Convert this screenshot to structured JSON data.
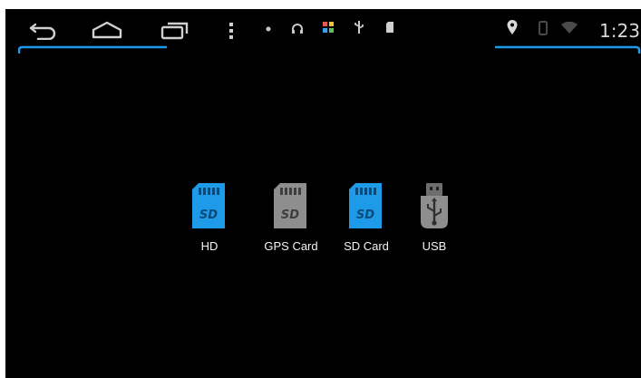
{
  "status_bar": {
    "nav": [
      {
        "name": "back",
        "icon": "back-arrow-icon"
      },
      {
        "name": "home",
        "icon": "home-icon"
      },
      {
        "name": "recents",
        "icon": "recent-apps-icon"
      },
      {
        "name": "menu",
        "icon": "overflow-menu-icon"
      }
    ],
    "notifications": [
      "notification-dot-icon",
      "headphones-icon",
      "app-grid-icon",
      "usb-icon",
      "sd-card-icon"
    ],
    "system_icons": [
      "location-icon",
      "vibrate-icon",
      "wifi-icon"
    ],
    "time": "1:23"
  },
  "colors": {
    "accent_blue": "#1e9be8",
    "icon_gray": "#8e8e8e",
    "background": "#000000",
    "text": "#f2f2f2"
  },
  "sources": [
    {
      "label": "HD",
      "icon": "sd-card-icon",
      "color": "blue"
    },
    {
      "label": "GPS Card",
      "icon": "sd-card-icon",
      "color": "gray"
    },
    {
      "label": "SD Card",
      "icon": "sd-card-icon",
      "color": "blue"
    },
    {
      "label": "USB",
      "icon": "usb-drive-icon",
      "color": "gray"
    }
  ]
}
